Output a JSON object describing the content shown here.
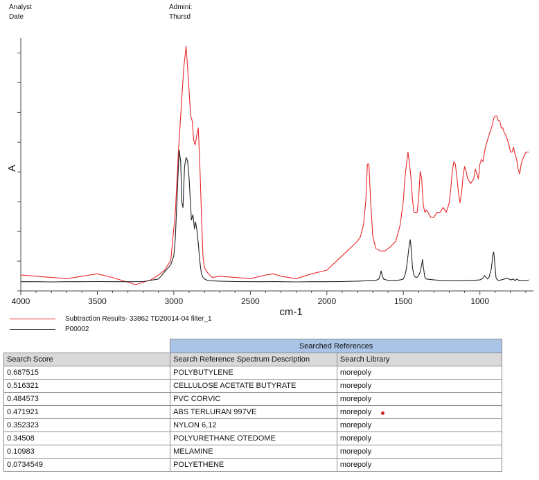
{
  "header": {
    "rows": [
      {
        "label": "Analyst",
        "value": "Admini:"
      },
      {
        "label": "Date",
        "value": "Thursd"
      }
    ]
  },
  "colors": {
    "subtraction_result": "#e8262a",
    "reference": "#222222",
    "table_caption_bg": "#a9c4e6",
    "table_header_bg": "#d9d9d9"
  },
  "chart_data": {
    "type": "line",
    "xlabel": "cm-1",
    "ylabel": "A",
    "xlim": [
      4000,
      650
    ],
    "x_reversed": true,
    "ylim": [
      0,
      1
    ],
    "x_ticks": [
      4000,
      3500,
      3000,
      2500,
      2000,
      1500,
      1000
    ],
    "y_ticks_labeled": false,
    "grid": false,
    "legend_position": "bottom-left",
    "series": [
      {
        "name": "Subtraction Results- 33862 TD20014-04 filter_1",
        "color": "#e8262a",
        "x": [
          4000,
          3900,
          3800,
          3700,
          3600,
          3500,
          3400,
          3300,
          3250,
          3200,
          3150,
          3100,
          3060,
          3020,
          2990,
          2970,
          2950,
          2935,
          2920,
          2910,
          2900,
          2890,
          2880,
          2870,
          2860,
          2850,
          2840,
          2830,
          2820,
          2810,
          2800,
          2780,
          2750,
          2700,
          2600,
          2500,
          2400,
          2350,
          2300,
          2200,
          2100,
          2000,
          1950,
          1900,
          1850,
          1800,
          1780,
          1760,
          1745,
          1735,
          1725,
          1715,
          1700,
          1680,
          1650,
          1620,
          1600,
          1580,
          1550,
          1520,
          1500,
          1490,
          1480,
          1470,
          1460,
          1450,
          1440,
          1430,
          1420,
          1410,
          1400,
          1390,
          1380,
          1370,
          1360,
          1350,
          1340,
          1320,
          1300,
          1280,
          1260,
          1240,
          1220,
          1200,
          1190,
          1180,
          1170,
          1160,
          1150,
          1140,
          1130,
          1120,
          1110,
          1100,
          1090,
          1080,
          1060,
          1040,
          1030,
          1020,
          1010,
          1000,
          990,
          980,
          970,
          960,
          950,
          940,
          930,
          920,
          910,
          900,
          890,
          880,
          870,
          860,
          850,
          840,
          830,
          820,
          810,
          800,
          790,
          780,
          770,
          760,
          750,
          740,
          730,
          720,
          700,
          680
        ],
        "y": [
          0.04,
          0.035,
          0.03,
          0.025,
          0.035,
          0.045,
          0.03,
          0.01,
          0.0,
          0.01,
          0.02,
          0.04,
          0.06,
          0.1,
          0.3,
          0.55,
          0.75,
          0.9,
          0.99,
          0.9,
          0.8,
          0.7,
          0.68,
          0.6,
          0.58,
          0.62,
          0.65,
          0.5,
          0.3,
          0.12,
          0.07,
          0.05,
          0.03,
          0.035,
          0.03,
          0.025,
          0.04,
          0.045,
          0.035,
          0.025,
          0.045,
          0.06,
          0.09,
          0.12,
          0.15,
          0.18,
          0.2,
          0.25,
          0.35,
          0.5,
          0.5,
          0.36,
          0.2,
          0.15,
          0.14,
          0.14,
          0.15,
          0.16,
          0.18,
          0.25,
          0.35,
          0.44,
          0.5,
          0.55,
          0.5,
          0.44,
          0.35,
          0.3,
          0.3,
          0.3,
          0.36,
          0.47,
          0.44,
          0.33,
          0.3,
          0.31,
          0.3,
          0.28,
          0.28,
          0.3,
          0.3,
          0.32,
          0.3,
          0.34,
          0.4,
          0.47,
          0.51,
          0.5,
          0.44,
          0.38,
          0.34,
          0.38,
          0.45,
          0.49,
          0.47,
          0.44,
          0.42,
          0.44,
          0.48,
          0.46,
          0.44,
          0.5,
          0.52,
          0.51,
          0.55,
          0.58,
          0.6,
          0.62,
          0.64,
          0.66,
          0.69,
          0.7,
          0.7,
          0.68,
          0.68,
          0.65,
          0.65,
          0.63,
          0.62,
          0.6,
          0.58,
          0.55,
          0.55,
          0.57,
          0.54,
          0.52,
          0.48,
          0.46,
          0.5,
          0.52,
          0.55,
          0.55
        ]
      },
      {
        "name": "P00002",
        "color": "#222222",
        "x": [
          4000,
          3900,
          3800,
          3700,
          3600,
          3500,
          3400,
          3300,
          3200,
          3100,
          3080,
          3060,
          3040,
          3020,
          3000,
          2990,
          2975,
          2965,
          2955,
          2948,
          2940,
          2930,
          2920,
          2910,
          2900,
          2892,
          2885,
          2875,
          2865,
          2858,
          2850,
          2840,
          2830,
          2820,
          2810,
          2800,
          2780,
          2750,
          2700,
          2600,
          2500,
          2400,
          2350,
          2300,
          2200,
          2100,
          2000,
          1900,
          1800,
          1750,
          1720,
          1700,
          1680,
          1660,
          1650,
          1645,
          1640,
          1630,
          1600,
          1550,
          1520,
          1500,
          1490,
          1480,
          1470,
          1460,
          1455,
          1450,
          1440,
          1430,
          1420,
          1410,
          1400,
          1390,
          1380,
          1375,
          1370,
          1360,
          1350,
          1300,
          1250,
          1200,
          1150,
          1100,
          1050,
          1000,
          980,
          970,
          960,
          950,
          940,
          925,
          915,
          910,
          905,
          900,
          895,
          890,
          880,
          860,
          840,
          820,
          800,
          780,
          770,
          760,
          750,
          740,
          720,
          700,
          680
        ],
        "y": [
          0.005,
          0.005,
          0.004,
          0.005,
          0.005,
          0.006,
          0.005,
          0.005,
          0.006,
          0.02,
          0.04,
          0.06,
          0.08,
          0.1,
          0.15,
          0.25,
          0.55,
          0.74,
          0.68,
          0.45,
          0.42,
          0.65,
          0.7,
          0.68,
          0.58,
          0.45,
          0.35,
          0.38,
          0.3,
          0.34,
          0.3,
          0.22,
          0.12,
          0.05,
          0.03,
          0.02,
          0.012,
          0.01,
          0.008,
          0.006,
          0.005,
          0.005,
          0.006,
          0.005,
          0.004,
          0.005,
          0.005,
          0.006,
          0.008,
          0.01,
          0.012,
          0.01,
          0.012,
          0.02,
          0.05,
          0.065,
          0.045,
          0.02,
          0.012,
          0.012,
          0.015,
          0.02,
          0.04,
          0.08,
          0.15,
          0.22,
          0.24,
          0.2,
          0.08,
          0.04,
          0.03,
          0.03,
          0.04,
          0.06,
          0.1,
          0.13,
          0.09,
          0.03,
          0.02,
          0.015,
          0.012,
          0.01,
          0.01,
          0.012,
          0.012,
          0.015,
          0.025,
          0.04,
          0.03,
          0.02,
          0.03,
          0.08,
          0.16,
          0.17,
          0.13,
          0.08,
          0.03,
          0.02,
          0.012,
          0.015,
          0.02,
          0.025,
          0.015,
          0.02,
          0.01,
          0.02,
          0.015,
          0.01,
          0.012,
          0.01,
          0.015
        ]
      }
    ]
  },
  "table": {
    "caption": "Searched References",
    "headers": [
      "Search Score",
      "Search Reference Spectrum Description",
      "Search Library"
    ],
    "rows": [
      [
        "0.687515",
        "POLYBUTYLENE",
        "morepoly"
      ],
      [
        "0.516321",
        "CELLULOSE ACETATE BUTYRATE",
        "morepoly"
      ],
      [
        "0.484573",
        "PVC CORVIC",
        "morepoly"
      ],
      [
        "0.471921",
        "ABS TERLURAN 997VE",
        "morepoly"
      ],
      [
        "0.352323",
        "NYLON 6,12",
        "morepoly"
      ],
      [
        "0.34508",
        "POLYURETHANE  OTEDOME",
        "morepoly"
      ],
      [
        "0.10983",
        "MELAMINE",
        "morepoly"
      ],
      [
        "0.0734549",
        "POLYETHENE",
        "morepoly"
      ]
    ]
  }
}
